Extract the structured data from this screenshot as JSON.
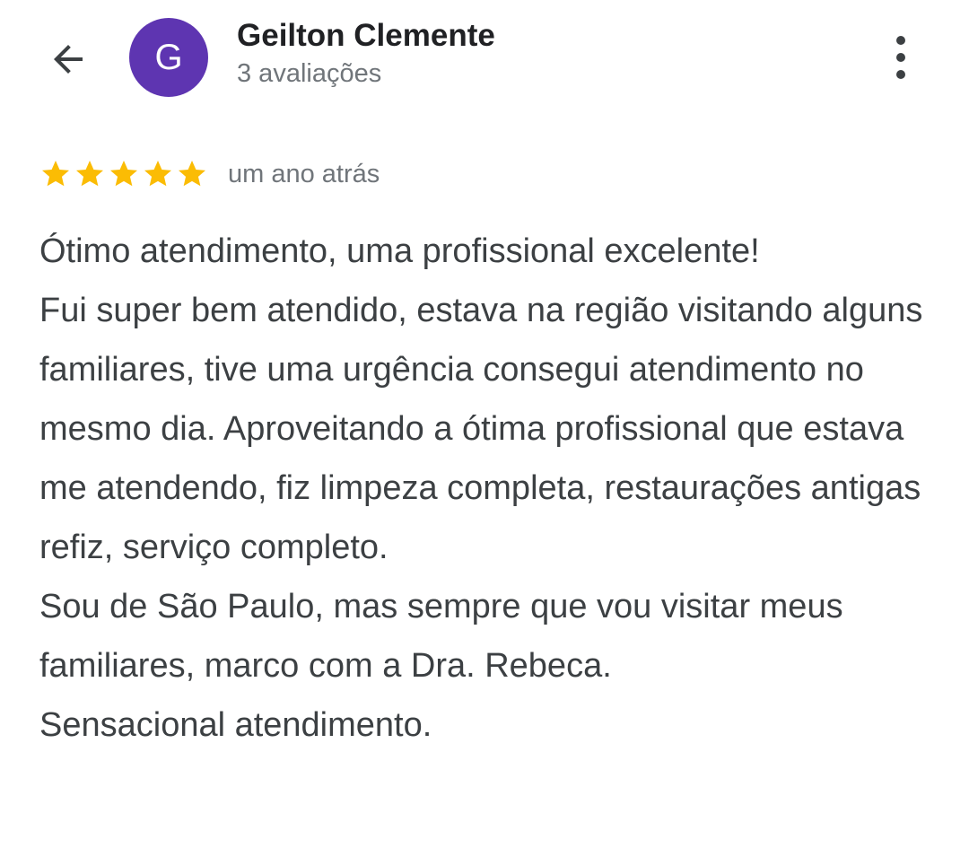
{
  "header": {
    "back_icon": "arrow-back-icon",
    "avatar_letter": "G",
    "avatar_color": "#5e35b1",
    "user_name": "Geilton Clemente",
    "review_count": "3 avaliações",
    "more_icon": "more-vertical-icon"
  },
  "review": {
    "rating": 5,
    "max_rating": 5,
    "star_color": "#fbbc04",
    "date": "um ano atrás",
    "text": "Ótimo atendimento, uma profissional excelente!\nFui super bem atendido, estava na região visitando alguns familiares, tive uma urgência consegui atendimento no mesmo dia. Aproveitando a ótima profissional que estava me atendendo, fiz limpeza completa, restaurações antigas refiz, serviço completo.\nSou de São Paulo, mas sempre que vou visitar meus familiares, marco com a Dra. Rebeca.\nSensacional atendimento."
  }
}
